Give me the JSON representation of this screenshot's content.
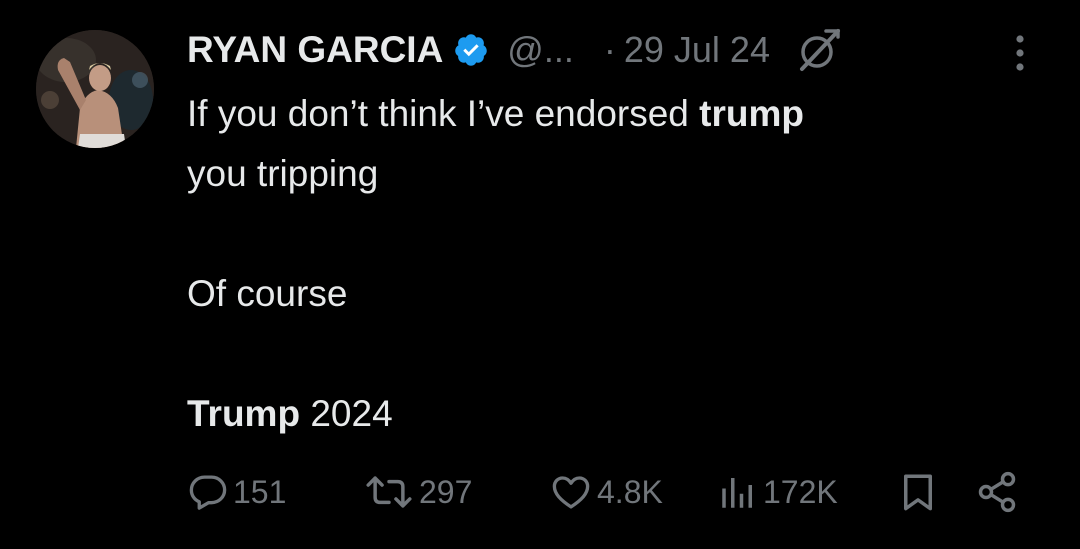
{
  "author": {
    "name": "RYAN GARCIA",
    "handle": "@...",
    "verified_color": "#1d9bf0",
    "avatar_icon": "profile-photo"
  },
  "meta": {
    "separator": "·",
    "date": "29 Jul 24"
  },
  "tweet": {
    "line1_prefix": "If you don’t think I’ve endorsed ",
    "line1_bold": "trump",
    "line2": "you tripping",
    "line3": "Of course",
    "line4_bold": "Trump",
    "line4_suffix": " 2024"
  },
  "actions": {
    "replies": "151",
    "reposts": "297",
    "likes": "4.8K",
    "views": "172K",
    "icons": [
      "reply-icon",
      "repost-icon",
      "like-icon",
      "views-icon",
      "bookmark-icon",
      "share-icon"
    ]
  },
  "colors": {
    "background": "#000000",
    "text": "#e7e9ea",
    "secondary": "#71767b",
    "verified": "#1d9bf0"
  }
}
